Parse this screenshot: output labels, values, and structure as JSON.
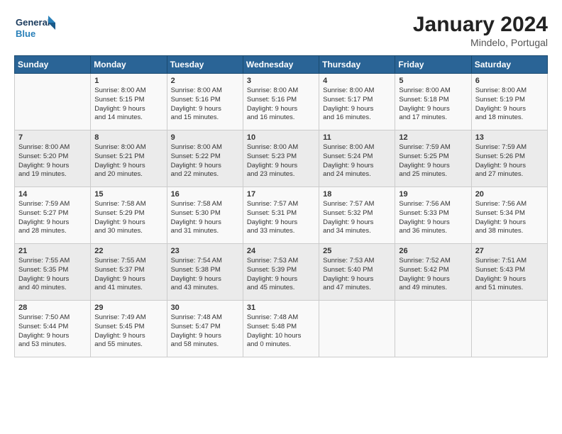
{
  "logo": {
    "line1": "General",
    "line2": "Blue"
  },
  "title": "January 2024",
  "subtitle": "Mindelo, Portugal",
  "header_days": [
    "Sunday",
    "Monday",
    "Tuesday",
    "Wednesday",
    "Thursday",
    "Friday",
    "Saturday"
  ],
  "weeks": [
    [
      {
        "day": "",
        "lines": []
      },
      {
        "day": "1",
        "lines": [
          "Sunrise: 8:00 AM",
          "Sunset: 5:15 PM",
          "Daylight: 9 hours",
          "and 14 minutes."
        ]
      },
      {
        "day": "2",
        "lines": [
          "Sunrise: 8:00 AM",
          "Sunset: 5:16 PM",
          "Daylight: 9 hours",
          "and 15 minutes."
        ]
      },
      {
        "day": "3",
        "lines": [
          "Sunrise: 8:00 AM",
          "Sunset: 5:16 PM",
          "Daylight: 9 hours",
          "and 16 minutes."
        ]
      },
      {
        "day": "4",
        "lines": [
          "Sunrise: 8:00 AM",
          "Sunset: 5:17 PM",
          "Daylight: 9 hours",
          "and 16 minutes."
        ]
      },
      {
        "day": "5",
        "lines": [
          "Sunrise: 8:00 AM",
          "Sunset: 5:18 PM",
          "Daylight: 9 hours",
          "and 17 minutes."
        ]
      },
      {
        "day": "6",
        "lines": [
          "Sunrise: 8:00 AM",
          "Sunset: 5:19 PM",
          "Daylight: 9 hours",
          "and 18 minutes."
        ]
      }
    ],
    [
      {
        "day": "7",
        "lines": [
          "Sunrise: 8:00 AM",
          "Sunset: 5:20 PM",
          "Daylight: 9 hours",
          "and 19 minutes."
        ]
      },
      {
        "day": "8",
        "lines": [
          "Sunrise: 8:00 AM",
          "Sunset: 5:21 PM",
          "Daylight: 9 hours",
          "and 20 minutes."
        ]
      },
      {
        "day": "9",
        "lines": [
          "Sunrise: 8:00 AM",
          "Sunset: 5:22 PM",
          "Daylight: 9 hours",
          "and 22 minutes."
        ]
      },
      {
        "day": "10",
        "lines": [
          "Sunrise: 8:00 AM",
          "Sunset: 5:23 PM",
          "Daylight: 9 hours",
          "and 23 minutes."
        ]
      },
      {
        "day": "11",
        "lines": [
          "Sunrise: 8:00 AM",
          "Sunset: 5:24 PM",
          "Daylight: 9 hours",
          "and 24 minutes."
        ]
      },
      {
        "day": "12",
        "lines": [
          "Sunrise: 7:59 AM",
          "Sunset: 5:25 PM",
          "Daylight: 9 hours",
          "and 25 minutes."
        ]
      },
      {
        "day": "13",
        "lines": [
          "Sunrise: 7:59 AM",
          "Sunset: 5:26 PM",
          "Daylight: 9 hours",
          "and 27 minutes."
        ]
      }
    ],
    [
      {
        "day": "14",
        "lines": [
          "Sunrise: 7:59 AM",
          "Sunset: 5:27 PM",
          "Daylight: 9 hours",
          "and 28 minutes."
        ]
      },
      {
        "day": "15",
        "lines": [
          "Sunrise: 7:58 AM",
          "Sunset: 5:29 PM",
          "Daylight: 9 hours",
          "and 30 minutes."
        ]
      },
      {
        "day": "16",
        "lines": [
          "Sunrise: 7:58 AM",
          "Sunset: 5:30 PM",
          "Daylight: 9 hours",
          "and 31 minutes."
        ]
      },
      {
        "day": "17",
        "lines": [
          "Sunrise: 7:57 AM",
          "Sunset: 5:31 PM",
          "Daylight: 9 hours",
          "and 33 minutes."
        ]
      },
      {
        "day": "18",
        "lines": [
          "Sunrise: 7:57 AM",
          "Sunset: 5:32 PM",
          "Daylight: 9 hours",
          "and 34 minutes."
        ]
      },
      {
        "day": "19",
        "lines": [
          "Sunrise: 7:56 AM",
          "Sunset: 5:33 PM",
          "Daylight: 9 hours",
          "and 36 minutes."
        ]
      },
      {
        "day": "20",
        "lines": [
          "Sunrise: 7:56 AM",
          "Sunset: 5:34 PM",
          "Daylight: 9 hours",
          "and 38 minutes."
        ]
      }
    ],
    [
      {
        "day": "21",
        "lines": [
          "Sunrise: 7:55 AM",
          "Sunset: 5:35 PM",
          "Daylight: 9 hours",
          "and 40 minutes."
        ]
      },
      {
        "day": "22",
        "lines": [
          "Sunrise: 7:55 AM",
          "Sunset: 5:37 PM",
          "Daylight: 9 hours",
          "and 41 minutes."
        ]
      },
      {
        "day": "23",
        "lines": [
          "Sunrise: 7:54 AM",
          "Sunset: 5:38 PM",
          "Daylight: 9 hours",
          "and 43 minutes."
        ]
      },
      {
        "day": "24",
        "lines": [
          "Sunrise: 7:53 AM",
          "Sunset: 5:39 PM",
          "Daylight: 9 hours",
          "and 45 minutes."
        ]
      },
      {
        "day": "25",
        "lines": [
          "Sunrise: 7:53 AM",
          "Sunset: 5:40 PM",
          "Daylight: 9 hours",
          "and 47 minutes."
        ]
      },
      {
        "day": "26",
        "lines": [
          "Sunrise: 7:52 AM",
          "Sunset: 5:42 PM",
          "Daylight: 9 hours",
          "and 49 minutes."
        ]
      },
      {
        "day": "27",
        "lines": [
          "Sunrise: 7:51 AM",
          "Sunset: 5:43 PM",
          "Daylight: 9 hours",
          "and 51 minutes."
        ]
      }
    ],
    [
      {
        "day": "28",
        "lines": [
          "Sunrise: 7:50 AM",
          "Sunset: 5:44 PM",
          "Daylight: 9 hours",
          "and 53 minutes."
        ]
      },
      {
        "day": "29",
        "lines": [
          "Sunrise: 7:49 AM",
          "Sunset: 5:45 PM",
          "Daylight: 9 hours",
          "and 55 minutes."
        ]
      },
      {
        "day": "30",
        "lines": [
          "Sunrise: 7:48 AM",
          "Sunset: 5:47 PM",
          "Daylight: 9 hours",
          "and 58 minutes."
        ]
      },
      {
        "day": "31",
        "lines": [
          "Sunrise: 7:48 AM",
          "Sunset: 5:48 PM",
          "Daylight: 10 hours",
          "and 0 minutes."
        ]
      },
      {
        "day": "",
        "lines": []
      },
      {
        "day": "",
        "lines": []
      },
      {
        "day": "",
        "lines": []
      }
    ]
  ]
}
